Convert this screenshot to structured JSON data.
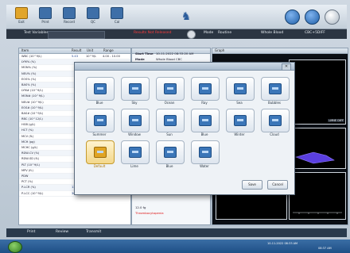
{
  "toolbar": {
    "buttons": [
      {
        "label": "Exit",
        "icon": "exit-icon"
      },
      {
        "label": "Print",
        "icon": "print-icon"
      },
      {
        "label": "Record",
        "icon": "record-icon"
      },
      {
        "label": "QC",
        "icon": "qc-icon"
      },
      {
        "label": "Cal",
        "icon": "cal-icon"
      }
    ]
  },
  "bar2": {
    "test_label": "Test Variables",
    "status_red": "Results Not Released",
    "mode_label": "Mode",
    "mode_value": "Routine",
    "blood_label": "Whole Blood",
    "cbc_label": "CBC+5DIFF"
  },
  "leftpane": {
    "headers": [
      "Item",
      "Result",
      "Unit",
      "Range"
    ],
    "rows": [
      {
        "name": "WBC (10^9/L)",
        "value": "5.43",
        "unit": "10^9/L",
        "range": "4.00 - 10.00"
      },
      {
        "name": "LYM% (%)"
      },
      {
        "name": "MON% (%)"
      },
      {
        "name": "NEU% (%)"
      },
      {
        "name": "EOS% (%)"
      },
      {
        "name": "BAS% (%)"
      },
      {
        "name": "LYM# (10^9/L)"
      },
      {
        "name": "MON# (10^9/L)"
      },
      {
        "name": "NEU# (10^9/L)"
      },
      {
        "name": "EOS# (10^9/L)"
      },
      {
        "name": "BAS# (10^9/L)"
      },
      {
        "name": "RBC (10^12/L)"
      },
      {
        "name": "HGB (g/L)"
      },
      {
        "name": "HCT (%)"
      },
      {
        "name": "MCV (fL)"
      },
      {
        "name": "MCH (pg)"
      },
      {
        "name": "MCHC (g/L)"
      },
      {
        "name": "RDW-CV (%)"
      },
      {
        "name": "RDW-SD (fL)"
      },
      {
        "name": "PLT (10^9/L)"
      },
      {
        "name": "MPV (fL)"
      },
      {
        "name": "PDW"
      },
      {
        "name": "PCT (%)"
      },
      {
        "name": "P-LCR (%)",
        "value": "13.0",
        "unit": "%",
        "range": "13.0 - 43.0"
      },
      {
        "name": "P-LCC (10^9/L)",
        "value": "30",
        "unit": "10^9/L",
        "range": "13 - 129"
      }
    ]
  },
  "midpane": {
    "start_time_label": "Start Time",
    "start_time": "10-11-2022 08:33:20 AM",
    "mode_label": "Mode",
    "mode_value": "Whole Blood CBC",
    "flag_value": "12.0 fg",
    "flag_red": "Thrombocytopenia"
  },
  "graphpane": {
    "title": "Graph",
    "label1": "LMNE DIFF",
    "label2": "RBC",
    "label3": "PLT"
  },
  "dialog": {
    "items": [
      {
        "label": "Blue",
        "icon": "theme-blue-icon"
      },
      {
        "label": "Sky",
        "icon": "theme-sky-icon"
      },
      {
        "label": "Ocean",
        "icon": "theme-ocean-icon"
      },
      {
        "label": "Ray",
        "icon": "theme-ray-icon"
      },
      {
        "label": "Sea",
        "icon": "theme-sea-icon"
      },
      {
        "label": "Bubbles",
        "icon": "theme-bubbles-icon"
      },
      {
        "label": "Summer",
        "icon": "theme-summer-icon"
      },
      {
        "label": "Window",
        "icon": "theme-window-icon"
      },
      {
        "label": "Sun",
        "icon": "theme-sun-icon"
      },
      {
        "label": "Blue",
        "icon": "theme-blue2-icon"
      },
      {
        "label": "Winter",
        "icon": "theme-winter-icon"
      },
      {
        "label": "Cloud",
        "icon": "theme-cloud-icon"
      },
      {
        "label": "Default",
        "icon": "theme-default-icon"
      },
      {
        "label": "Lime",
        "icon": "theme-lime-icon"
      },
      {
        "label": "Blue",
        "icon": "theme-blue3-icon"
      },
      {
        "label": "Water",
        "icon": "theme-water-icon"
      }
    ],
    "save_label": "Save",
    "cancel_label": "Cancel"
  },
  "statusbar": {
    "tabs": [
      "Print",
      "Review",
      "Transmit"
    ]
  },
  "taskbar": {
    "clock": "10-11-2022 08:33 AM",
    "time": "08:37 AM"
  }
}
